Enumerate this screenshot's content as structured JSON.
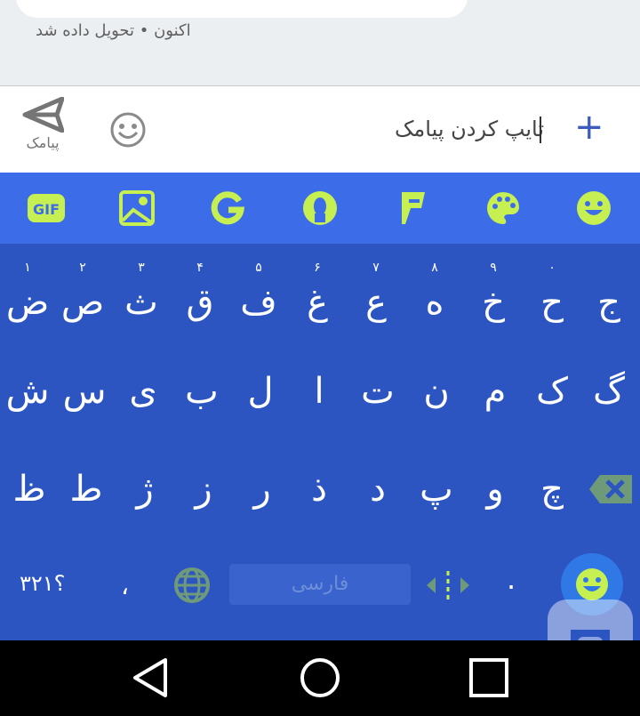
{
  "conversation": {
    "status": "اکنون • تحویل داده شد"
  },
  "compose": {
    "message_text": "تایپ کردن پیامک",
    "send_label": "پیامک"
  },
  "keyboard": {
    "row1": [
      {
        "char": "ض",
        "hint": "۱"
      },
      {
        "char": "ص",
        "hint": "۲"
      },
      {
        "char": "ث",
        "hint": "۳"
      },
      {
        "char": "ق",
        "hint": "۴"
      },
      {
        "char": "ف",
        "hint": "۵"
      },
      {
        "char": "غ",
        "hint": "۶"
      },
      {
        "char": "ع",
        "hint": "۷"
      },
      {
        "char": "ه",
        "hint": "۸"
      },
      {
        "char": "خ",
        "hint": "۹"
      },
      {
        "char": "ح",
        "hint": "۰"
      },
      {
        "char": "ج",
        "hint": ""
      }
    ],
    "row2": [
      "ش",
      "س",
      "ی",
      "ب",
      "ل",
      "ا",
      "ت",
      "ن",
      "م",
      "ک",
      "گ"
    ],
    "row3": [
      "ظ",
      "ط",
      "ژ",
      "ز",
      "ر",
      "ذ",
      "د",
      "پ",
      "و",
      "چ"
    ],
    "symbols_label": "؟۳۲۱",
    "comma": "،",
    "space_label": "فارسی",
    "period": "."
  },
  "colors": {
    "keyboard_bg": "#2c55c2",
    "toolbar_bg": "#3d6ce8",
    "icon_accent": "#c6ef52"
  }
}
